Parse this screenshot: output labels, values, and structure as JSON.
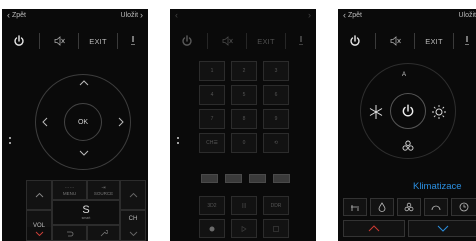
{
  "panels": [
    {
      "nav": {
        "back": "Zpět",
        "next": "Uložit"
      },
      "toolbar": {
        "exit": "EXIT"
      },
      "dpad": {
        "ok": "OK"
      },
      "bottom": {
        "vol": "VOL",
        "ch": "CH",
        "menu": "MENU",
        "source": "SOURCE",
        "smart_big": "S",
        "smart_small": "smart"
      }
    },
    {
      "toolbar": {
        "exit": "EXIT"
      },
      "keypad": {
        "keys": [
          "1",
          "2",
          "3",
          "4",
          "5",
          "6",
          "7",
          "8",
          "9",
          "CH☰",
          "0",
          "⟲"
        ]
      },
      "extras": {
        "row1": [
          "3D2",
          "|||",
          "DDR"
        ]
      },
      "color_keys": [
        "#9e2a2a",
        "#2d7a2d",
        "#b59a1c",
        "#2a4f9e"
      ]
    },
    {
      "nav": {
        "back": "Zpět",
        "next": "Uložit"
      },
      "toolbar": {
        "exit": "EXIT"
      },
      "climate": {
        "center_top": "A",
        "label": "Klimatizace"
      }
    }
  ],
  "colors": {
    "accent": "#2b8fe0",
    "panel_bg": "#0a0a0a"
  }
}
